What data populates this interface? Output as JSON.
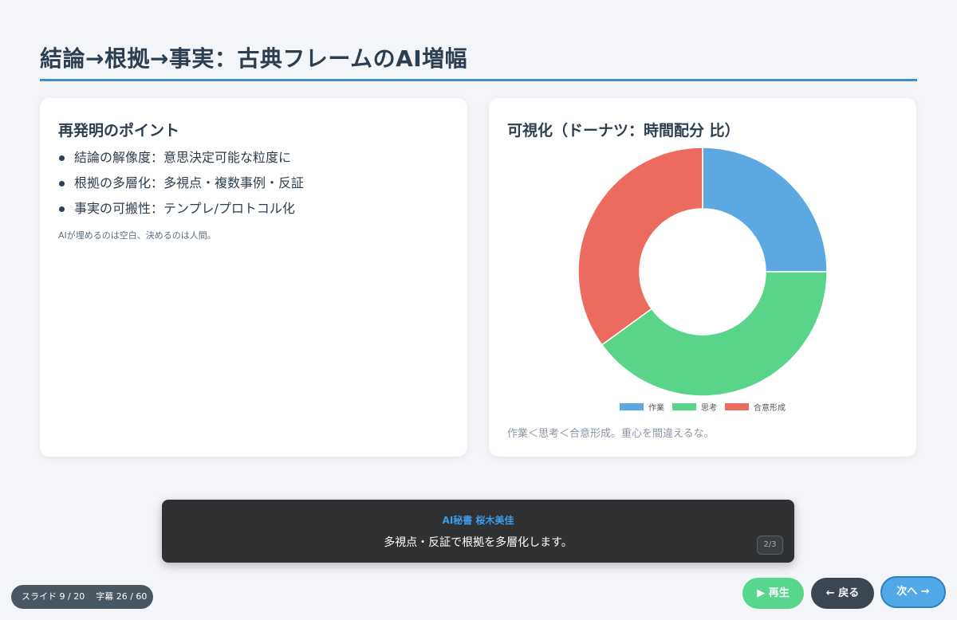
{
  "slide": {
    "title": "結論→根拠→事実：古典フレームのAI増幅"
  },
  "left_card": {
    "heading": "再発明のポイント",
    "points": [
      "結論の解像度：意思決定可能な粒度に",
      "根拠の多層化：多視点・複数事例・反証",
      "事実の可搬性：テンプレ/プロトコル化"
    ],
    "note": "AIが埋めるのは空白、決めるのは人間。"
  },
  "right_card": {
    "heading": "可視化（ドーナツ：時間配分 比）",
    "note": "作業＜思考＜合意形成。重心を間違えるな。"
  },
  "chart_data": {
    "type": "pie",
    "variant": "donut",
    "categories": [
      "作業",
      "思考",
      "合意形成"
    ],
    "values": [
      25,
      40,
      35
    ],
    "colors": [
      "#5ca8e0",
      "#5ad488",
      "#ec6b5e"
    ],
    "legend": "bottom",
    "title": ""
  },
  "subtitle": {
    "speaker": "AI秘書 桜木美佳",
    "text": "多視点・反証で根拠を多層化します。",
    "counter": "2/3"
  },
  "status": {
    "slide": "スライド 9 / 20",
    "caption": "字幕 26 / 60"
  },
  "buttons": {
    "play": "▶ 再生",
    "back": "← 戻る",
    "next": "次へ →"
  },
  "colors": {
    "title_rule": "#3f8fc4",
    "speaker": "#3d9be9",
    "play": "#58d68d",
    "back": "#3c4652",
    "next": "#52a9e8"
  }
}
